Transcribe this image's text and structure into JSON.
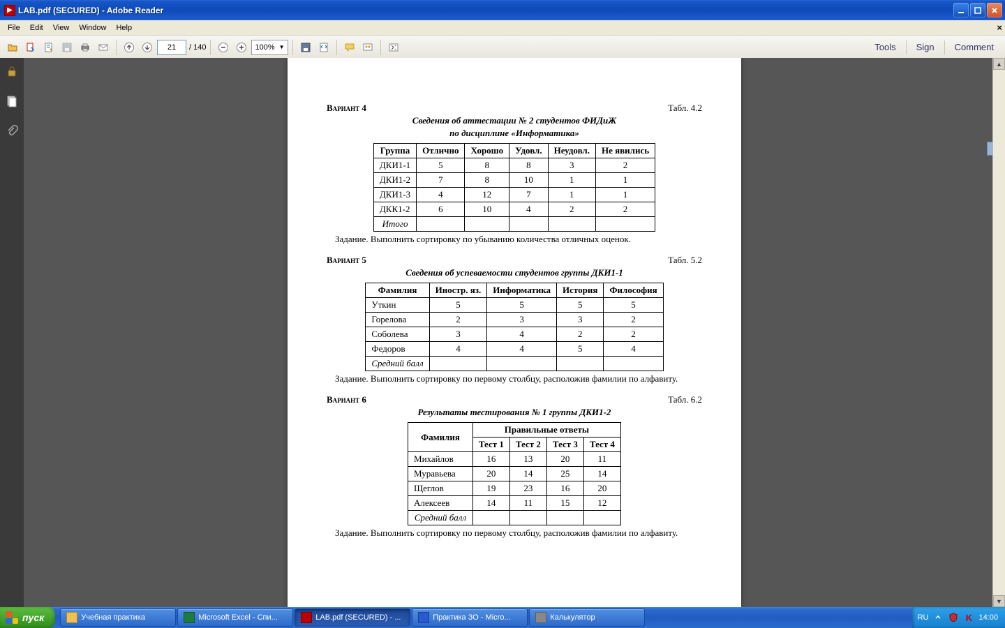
{
  "window": {
    "title": "LAB.pdf (SECURED) - Adobe Reader"
  },
  "menubar": [
    "File",
    "Edit",
    "View",
    "Window",
    "Help"
  ],
  "toolbar": {
    "page_current": "21",
    "page_total": "/ 140",
    "zoom": "100%",
    "links": [
      "Tools",
      "Sign",
      "Comment"
    ]
  },
  "doc": {
    "v4": {
      "variant": "Вариант 4",
      "tabl": "Табл. 4.2",
      "title1": "Сведения об аттестации № 2 студентов ФИДиЖ",
      "title2": "по дисциплине «Информатика»",
      "headers": [
        "Группа",
        "Отлично",
        "Хорошо",
        "Удовл.",
        "Неудовл.",
        "Не явились"
      ],
      "rows": [
        [
          "ДКИ1-1",
          "5",
          "8",
          "8",
          "3",
          "2"
        ],
        [
          "ДКИ1-2",
          "7",
          "8",
          "10",
          "1",
          "1"
        ],
        [
          "ДКИ1-3",
          "4",
          "12",
          "7",
          "1",
          "1"
        ],
        [
          "ДКК1-2",
          "6",
          "10",
          "4",
          "2",
          "2"
        ]
      ],
      "footer": "Итого",
      "task": "Задание. Выполнить сортировку по убыванию количества отличных оценок."
    },
    "v5": {
      "variant": "Вариант 5",
      "tabl": "Табл. 5.2",
      "title1": "Сведения об успеваемости студентов группы ДКИ1-1",
      "headers": [
        "Фамилия",
        "Иностр. яз.",
        "Информатика",
        "История",
        "Философия"
      ],
      "rows": [
        [
          "Уткин",
          "5",
          "5",
          "5",
          "5"
        ],
        [
          "Горелова",
          "2",
          "3",
          "3",
          "2"
        ],
        [
          "Соболева",
          "3",
          "4",
          "2",
          "2"
        ],
        [
          "Федоров",
          "4",
          "4",
          "5",
          "4"
        ]
      ],
      "footer": "Средний балл",
      "task": "Задание. Выполнить сортировку по первому столбцу, расположив фамилии по алфавиту."
    },
    "v6": {
      "variant": "Вариант 6",
      "tabl": "Табл. 6.2",
      "title1": "Результаты тестирования № 1 группы ДКИ1-2",
      "header_top": "Правильные ответы",
      "header_left": "Фамилия",
      "subheaders": [
        "Тест 1",
        "Тест 2",
        "Тест 3",
        "Тест 4"
      ],
      "rows": [
        [
          "Михайлов",
          "16",
          "13",
          "20",
          "11"
        ],
        [
          "Муравьева",
          "20",
          "14",
          "25",
          "14"
        ],
        [
          "Щеглов",
          "19",
          "23",
          "16",
          "20"
        ],
        [
          "Алексеев",
          "14",
          "11",
          "15",
          "12"
        ]
      ],
      "footer": "Средний балл",
      "task": "Задание. Выполнить сортировку по первому столбцу, расположив фамилии по алфавиту."
    }
  },
  "taskbar": {
    "start": "пуск",
    "buttons": [
      {
        "label": "Учебная практика",
        "color": "#f0c050"
      },
      {
        "label": "Microsoft Excel - Спи...",
        "color": "#1e7a3e"
      },
      {
        "label": "LAB.pdf (SECURED) - ...",
        "color": "#b00",
        "active": true
      },
      {
        "label": "Практика ЗО - Micro...",
        "color": "#2a5ad0"
      },
      {
        "label": "Калькулятор",
        "color": "#888"
      }
    ],
    "tray": {
      "lang": "RU",
      "time": "14:00"
    }
  }
}
